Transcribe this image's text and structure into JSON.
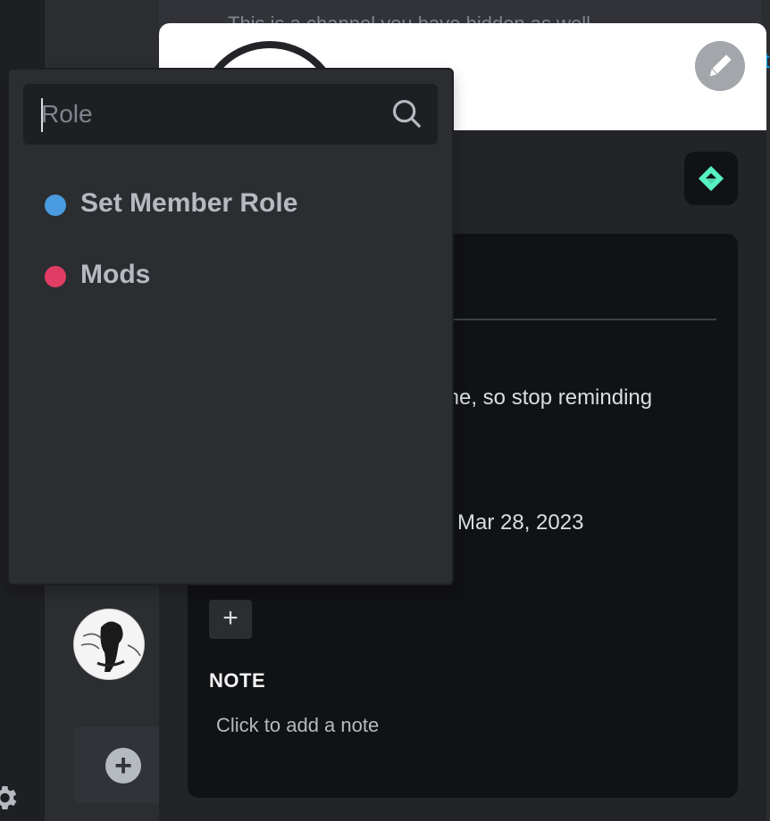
{
  "background": {
    "blurred_message": "This is a channel you have hidden as well.",
    "right_edge_link": "t"
  },
  "profile": {
    "about_me_fragment": "me, so stop reminding",
    "member_since": "Mar 28, 2023",
    "add_role_label": "+",
    "note_heading": "NOTE",
    "note_placeholder": "Click to add a note"
  },
  "role_picker": {
    "search_placeholder": "Role",
    "search_value": "",
    "roles": [
      {
        "label": "Set Member Role",
        "color": "#4a9be0"
      },
      {
        "label": "Mods",
        "color": "#e13d64"
      }
    ]
  },
  "sidebar": {
    "add_server_label": "+"
  },
  "colors": {
    "accent_blurple": "#5865f2",
    "nitro_green": "#57f2c1"
  },
  "icons": {
    "search": "search-icon",
    "edit": "pencil-icon",
    "nitro": "nitro-badge-icon",
    "settings": "gear-icon",
    "add": "plus-icon"
  }
}
